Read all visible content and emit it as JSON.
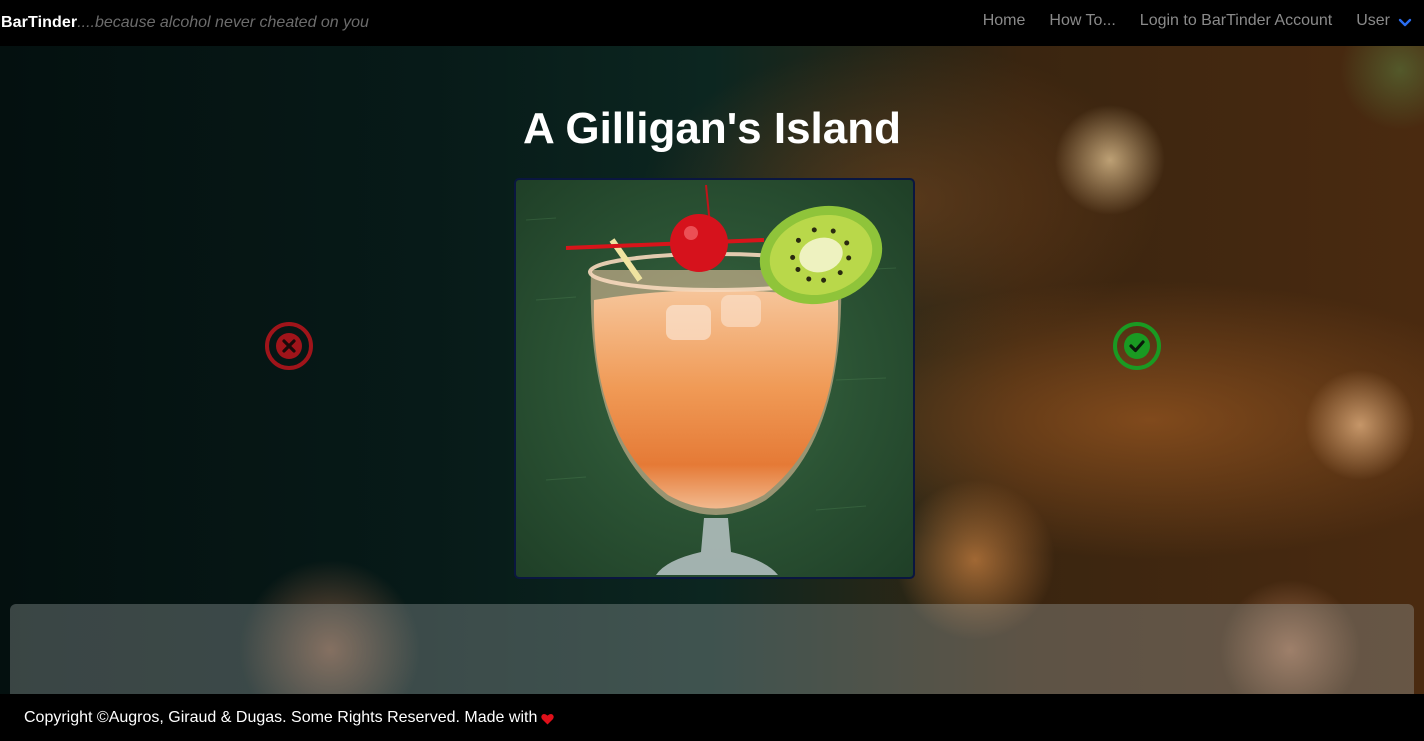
{
  "navbar": {
    "brand": "BarTinder",
    "tagline": "....because alcohol never cheated on you",
    "links": {
      "home": "Home",
      "howto": "How To...",
      "login": "Login to BarTinder Account",
      "user": "User"
    }
  },
  "drink": {
    "title": "A Gilligan's Island"
  },
  "actions": {
    "reject_icon": "x-circle-icon",
    "accept_icon": "check-circle-icon"
  },
  "footer": {
    "text": "Copyright ©Augros, Giraud & Dugas. Some Rights Reserved. Made with",
    "heart_icon": "heart-icon"
  },
  "colors": {
    "reject": "#a0141a",
    "accept": "#1a9a22",
    "user_chevron": "#2a6df0",
    "heart": "#e0101a"
  }
}
